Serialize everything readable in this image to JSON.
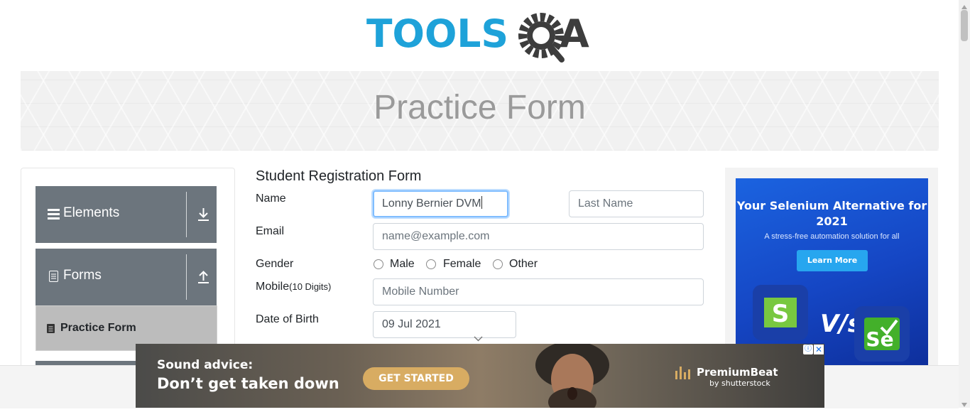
{
  "logo": {
    "text_left": "TOOLS",
    "text_right": "A"
  },
  "banner": {
    "title": "Practice Form"
  },
  "sidebar": {
    "groups": [
      {
        "label": "Elements",
        "icon": "list-icon",
        "toggle_icon": "download-arrow-icon"
      },
      {
        "label": "Forms",
        "icon": "document-icon",
        "toggle_icon": "upload-arrow-icon"
      }
    ],
    "active_item": {
      "label": "Practice Form",
      "icon": "form-icon"
    }
  },
  "form": {
    "title": "Student Registration Form",
    "name_label": "Name",
    "first_name_value": "Lonny Bernier DVM",
    "last_name_placeholder": "Last Name",
    "email_label": "Email",
    "email_placeholder": "name@example.com",
    "gender_label": "Gender",
    "gender_options": [
      "Male",
      "Female",
      "Other"
    ],
    "mobile_label": "Mobile",
    "mobile_hint": "(10 Digits)",
    "mobile_placeholder": "Mobile Number",
    "dob_label": "Date of Birth",
    "dob_value": "09 Jul 2021"
  },
  "ad_right": {
    "headline": "Your Selenium Alternative for 2021",
    "subtext": "A stress-free automation solution for all",
    "cta": "Learn More",
    "vs": "V/s"
  },
  "ad_bottom": {
    "line1": "Sound advice:",
    "line2": "Don’t get taken down",
    "cta": "GET STARTED",
    "brand": "PremiumBeat",
    "brand_sub": "by shutterstock"
  },
  "colors": {
    "brand_blue": "#1ea2d9",
    "brand_dark": "#444444",
    "sidebar_header": "#6c757d",
    "active_item": "#bcbcbc",
    "focus_border": "#80bdff",
    "ad_cta_gold": "#d8ac62"
  }
}
